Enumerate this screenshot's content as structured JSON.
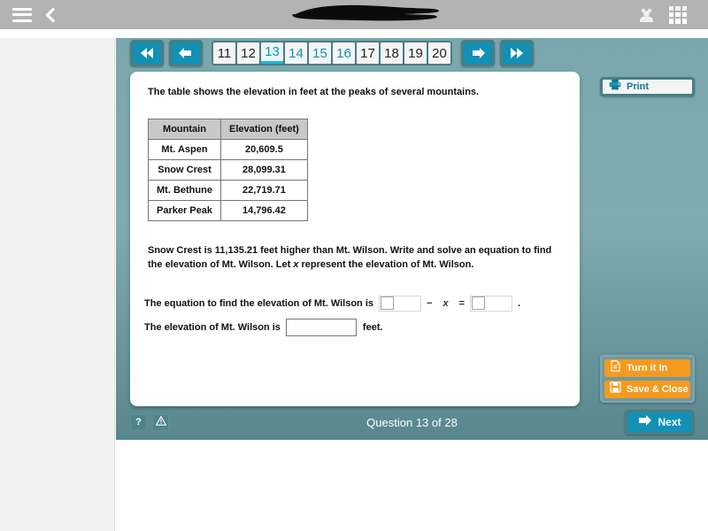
{
  "topbar": {
    "menu_icon": "hamburger-icon",
    "back_icon": "back-chevron-icon",
    "title_redacted": true,
    "people_icon": "people-icon",
    "apps_grid_icon": "grid-apps-icon"
  },
  "pager": {
    "first_label": "«",
    "prev_label": "‹",
    "next_label": "›",
    "last_label": "»",
    "pages": [
      {
        "num": "11",
        "state": "unvisited"
      },
      {
        "num": "12",
        "state": "unvisited"
      },
      {
        "num": "13",
        "state": "current"
      },
      {
        "num": "14",
        "state": "visited"
      },
      {
        "num": "15",
        "state": "visited"
      },
      {
        "num": "16",
        "state": "visited"
      },
      {
        "num": "17",
        "state": "unvisited"
      },
      {
        "num": "18",
        "state": "unvisited"
      },
      {
        "num": "19",
        "state": "unvisited"
      },
      {
        "num": "20",
        "state": "unvisited"
      }
    ]
  },
  "question": {
    "intro": "The table shows the elevation in feet at the peaks of several mountains.",
    "table": {
      "headers": [
        "Mountain",
        "Elevation (feet)"
      ],
      "rows": [
        [
          "Mt. Aspen",
          "20,609.5"
        ],
        [
          "Snow Crest",
          "28,099.31"
        ],
        [
          "Mt. Bethune",
          "22,719.71"
        ],
        [
          "Parker Peak",
          "14,796.42"
        ]
      ]
    },
    "body_line1": "Snow Crest is 11,135.21 feet higher than Mt. Wilson. Write and solve an equation to find the",
    "body_line2_a": "elevation of Mt. Wilson. Let ",
    "body_line2_var": "x",
    "body_line2_b": " represent the elevation of Mt. Wilson.",
    "answer": {
      "equation_label": "The equation to find the elevation of Mt. Wilson is",
      "minus_sign": "−",
      "variable": "x",
      "equals_sign": "=",
      "period": ".",
      "equation_left_value": "",
      "equation_right_value": "",
      "elevation_label": "The elevation of Mt. Wilson is",
      "elevation_value": "",
      "elevation_units": "feet."
    }
  },
  "sidebar": {
    "print_label": "Print",
    "print_icon": "printer-icon",
    "turn_in_label": "Turn it In",
    "turn_in_icon": "document-upload-icon",
    "save_close_label": "Save & Close",
    "save_close_icon": "floppy-disk-icon"
  },
  "bottom": {
    "help_label": "?",
    "help_icon": "question-mark-icon",
    "alert_icon": "warning-triangle-icon",
    "counter": "Question 13 of 28",
    "next_label": "Next",
    "next_icon": "arrow-right-icon"
  },
  "colors": {
    "accent_teal": "#1290b5",
    "panel_teal": "#7fabb1",
    "orange": "#f59a1e",
    "topbar_gray": "#b3b3b3"
  }
}
